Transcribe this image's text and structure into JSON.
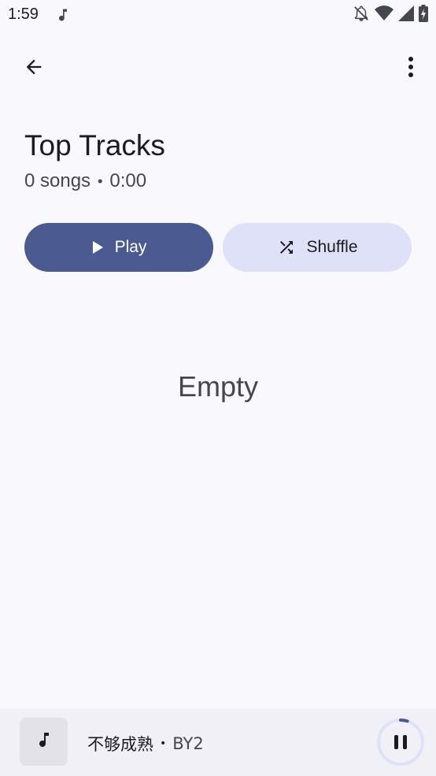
{
  "status_bar": {
    "time": "1:59",
    "icons": [
      "music-note-icon",
      "notifications-off-icon",
      "wifi-icon",
      "signal-icon",
      "battery-charging-icon"
    ]
  },
  "top_bar": {
    "back_icon": "arrow-back-icon",
    "more_icon": "more-vert-icon"
  },
  "playlist": {
    "title": "Top Tracks",
    "song_count": "0 songs",
    "separator": "•",
    "duration": "0:00"
  },
  "actions": {
    "play_label": "Play",
    "shuffle_label": "Shuffle"
  },
  "empty_state": {
    "text": "Empty"
  },
  "mini_player": {
    "track_title": "不够成熟",
    "separator": "•",
    "artist": "BY2",
    "progress": 0.05
  },
  "colors": {
    "background": "#f9f8fd",
    "primary": "#4b5a90",
    "secondary_container": "#dfe1f9",
    "mini_player_bg": "#f1f0f6"
  }
}
